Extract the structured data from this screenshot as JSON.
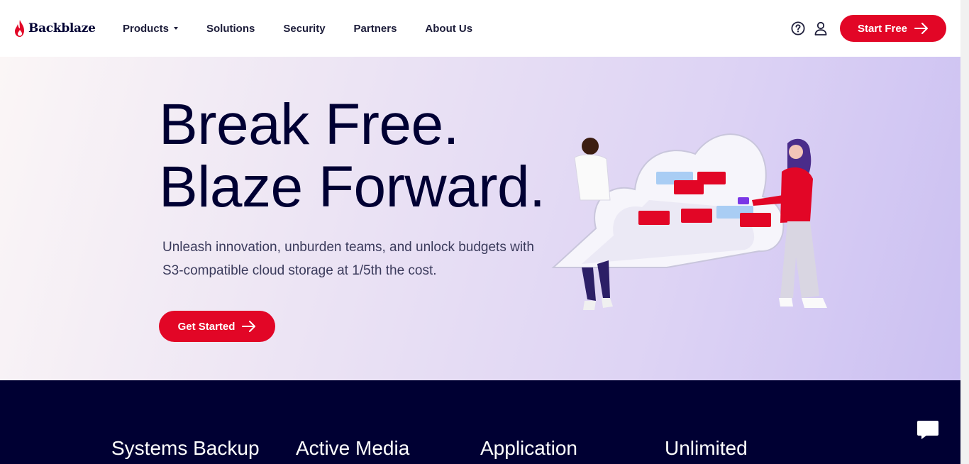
{
  "brand": {
    "name": "Backblaze",
    "accent": "#e20626",
    "navy": "#000033"
  },
  "nav": {
    "items": [
      {
        "label": "Products",
        "has_caret": true
      },
      {
        "label": "Solutions"
      },
      {
        "label": "Security"
      },
      {
        "label": "Partners"
      },
      {
        "label": "About Us"
      }
    ]
  },
  "header_icons": {
    "help": "help-circle-icon",
    "account": "user-icon"
  },
  "cta_header": {
    "label": "Start Free",
    "icon": "arrow-right-icon"
  },
  "hero": {
    "title_line1": "Break Free.",
    "title_line2": "Blaze Forward.",
    "subtitle": "Unleash innovation, unburden teams, and unlock budgets with S3-compatible cloud storage at 1/5th the cost.",
    "cta": {
      "label": "Get Started",
      "icon": "arrow-right-icon"
    }
  },
  "features": {
    "items": [
      {
        "label": "Systems Backup"
      },
      {
        "label": "Active Media"
      },
      {
        "label": "Application"
      },
      {
        "label": "Unlimited"
      }
    ]
  },
  "chat": {
    "icon": "chat-bubble-icon"
  }
}
